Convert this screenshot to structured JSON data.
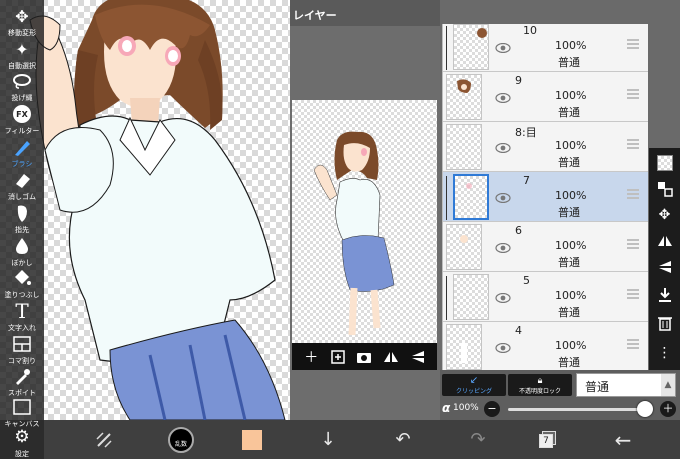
{
  "toolbar": {
    "items": [
      {
        "label": "移動変形",
        "icon": "move-icon"
      },
      {
        "label": "自動選択",
        "icon": "magic-wand-icon"
      },
      {
        "label": "投げ縄",
        "icon": "lasso-icon"
      },
      {
        "label": "フィルター",
        "icon": "filter-fx-icon"
      },
      {
        "label": "ブラシ",
        "icon": "brush-icon",
        "active": true
      },
      {
        "label": "消しゴム",
        "icon": "eraser-icon"
      },
      {
        "label": "指先",
        "icon": "finger-smudge-icon"
      },
      {
        "label": "ぼかし",
        "icon": "blur-drop-icon"
      },
      {
        "label": "塗りつぶし",
        "icon": "bucket-fill-icon"
      },
      {
        "label": "文字入れ",
        "icon": "text-tool-icon"
      },
      {
        "label": "コマ割り",
        "icon": "frame-divider-icon"
      },
      {
        "label": "スポイト",
        "icon": "eyedropper-icon"
      },
      {
        "label": "キャンバス",
        "icon": "canvas-icon"
      },
      {
        "label": "設定",
        "icon": "gear-icon"
      }
    ]
  },
  "layer_panel": {
    "title": "レイヤー",
    "layers": [
      {
        "number": "10",
        "opacity": "100%",
        "blend": "普通",
        "clipped": true
      },
      {
        "number": "9",
        "opacity": "100%",
        "blend": "普通",
        "clipped": false
      },
      {
        "number": "8:目",
        "opacity": "100%",
        "blend": "普通",
        "clipped": false
      },
      {
        "number": "7",
        "opacity": "100%",
        "blend": "普通",
        "clipped": true,
        "selected": true
      },
      {
        "number": "6",
        "opacity": "100%",
        "blend": "普通",
        "clipped": false
      },
      {
        "number": "5",
        "opacity": "100%",
        "blend": "普通",
        "clipped": true
      },
      {
        "number": "4",
        "opacity": "100%",
        "blend": "普通",
        "clipped": false
      }
    ],
    "clipping_label": "クリッピング",
    "alpha_lock_label": "不透明度ロック",
    "blend_mode": "普通",
    "alpha_symbol": "α",
    "alpha_value": "100%"
  },
  "bottom_bar": {
    "brush_size_label": "乱数",
    "layer_count": "7",
    "foreground_color": "#f9c59a"
  },
  "colors": {
    "accent": "#2f7ad6",
    "selected_layer": "#c8d7ec",
    "skirt": "#7a93d4"
  }
}
